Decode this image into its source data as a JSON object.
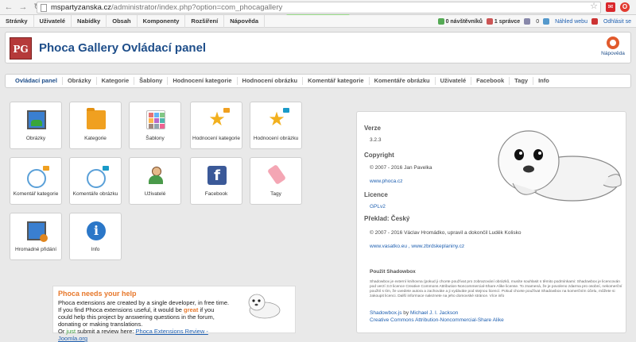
{
  "browser": {
    "url_host": "mspartyzanska.cz",
    "url_path": "/administrator/index.php?option=com_phocagallery"
  },
  "admin_menu": {
    "items": [
      "Stránky",
      "Uživatelé",
      "Nabídky",
      "Obsah",
      "Komponenty",
      "Rozšíření",
      "Nápověda"
    ],
    "messages": "0 návštěvníků",
    "admins": "1 správce",
    "count": "0",
    "preview": "Náhled webu",
    "logout": "Odhlásit se"
  },
  "header": {
    "logo": "PG",
    "title": "Phoca Gallery Ovládací panel",
    "help": "Nápověda"
  },
  "submenu": {
    "items": [
      "Ovládací panel",
      "Obrázky",
      "Kategorie",
      "Šablony",
      "Hodnocení kategorie",
      "Hodnocení obrázku",
      "Komentář kategorie",
      "Komentáře obrázku",
      "Uživatelé",
      "Facebook",
      "Tagy",
      "Info"
    ]
  },
  "tiles": [
    {
      "label": "Obrázky",
      "icon": "image-icon"
    },
    {
      "label": "Kategorie",
      "icon": "folder-icon"
    },
    {
      "label": "Šablony",
      "icon": "templates-icon"
    },
    {
      "label": "Hodnocení kategorie",
      "icon": "star-folder-icon"
    },
    {
      "label": "Hodnocení obrázku",
      "icon": "star-image-icon"
    },
    {
      "label": "Komentář kategorie",
      "icon": "comment-folder-icon"
    },
    {
      "label": "Komentáře obrázku",
      "icon": "comment-image-icon"
    },
    {
      "label": "Uživatelé",
      "icon": "user-icon"
    },
    {
      "label": "Facebook",
      "icon": "facebook-icon"
    },
    {
      "label": "Tagy",
      "icon": "tag-icon"
    },
    {
      "label": "Hromadné přidání",
      "icon": "multiple-add-icon"
    },
    {
      "label": "Info",
      "icon": "info-icon"
    }
  ],
  "promo": {
    "title": "Phoca needs your help",
    "line1": "Phoca extensions are created by a single developer, in free time.",
    "line2a": "If you find Phoca extensions useful, it would be ",
    "great": "great",
    "line2b": " if you",
    "line3": "could help this project by answering questions in the forum,",
    "line4": "donating or making translations.",
    "or": "Or ",
    "just": "just",
    "line5": " submit a review here: ",
    "link": "Phoca Extensions Review - Joomla.org"
  },
  "info": {
    "version_h": "Verze",
    "version": "3.2.3",
    "copyright_h": "Copyright",
    "copyright": "© 2007 - 2016 Jan Pavelka",
    "site": "www.phoca.cz",
    "license_h": "Licence",
    "license": "GPLv2",
    "translation_h": "Překlad: Český",
    "translation": "© 2007 - 2016 Václav Hromádko, upravil a dokončil Luděk Kolisko",
    "translation_links": "www.vasatko.eu , www.zbrdskeplaniny.cz",
    "shadowbox_h": "Použit Shadowbox",
    "shadowbox_text": "Shadowbox je externí knihovna (pokud ji chcete používat pro zobrazování obrázků, musíte souhlasit s těmito podmínkami: Shadowbox je licencován pod verzí 3.0 licence Creative Commons Attribution-Noncommercial-Share Alike license. To znamená, že je povoleno zdarma pro osobní, nekomerční použití s tím, že uvedete autora a zachováte a ji vydáváte pod stejnou licencí. Pokud chcete používat Shadowbox na komerčním účelu, můžete si zakoupit licenci. Další informace naleznete na jeho domovské stránce. Více info",
    "shadowbox_by": "Shadowbox.js",
    "shadowbox_by_text": " by ",
    "shadowbox_author": "Michael J. I. Jackson",
    "shadowbox_license": "Creative Commons Attribution-Noncommercial-Share Alike"
  }
}
